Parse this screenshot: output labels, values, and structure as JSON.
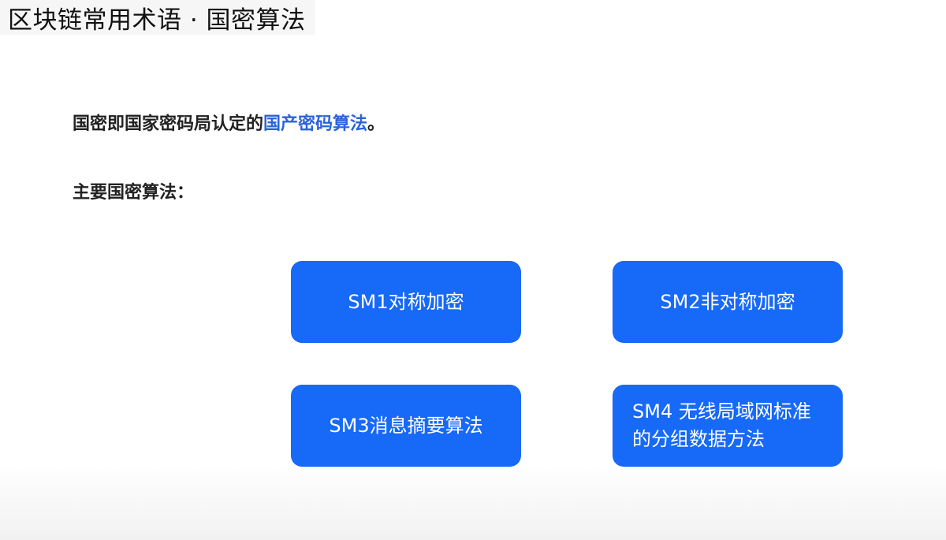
{
  "slide": {
    "title": "区块链常用术语 · 国密算法",
    "intro": {
      "prefix": "国密即国家密码局认定的",
      "highlight": "国产密码算法",
      "suffix": "。"
    },
    "subheading": "主要国密算法：",
    "algorithms": [
      {
        "label": "SM1对称加密"
      },
      {
        "label": "SM2非对称加密"
      },
      {
        "label": "SM3消息摘要算法"
      },
      {
        "label": "SM4 无线局域网标准的分组数据方法"
      }
    ],
    "colors": {
      "card_background": "#1769f7",
      "highlight_text": "#2b63d9",
      "body_text": "#222222",
      "title_background": "#f6f6f6"
    }
  }
}
